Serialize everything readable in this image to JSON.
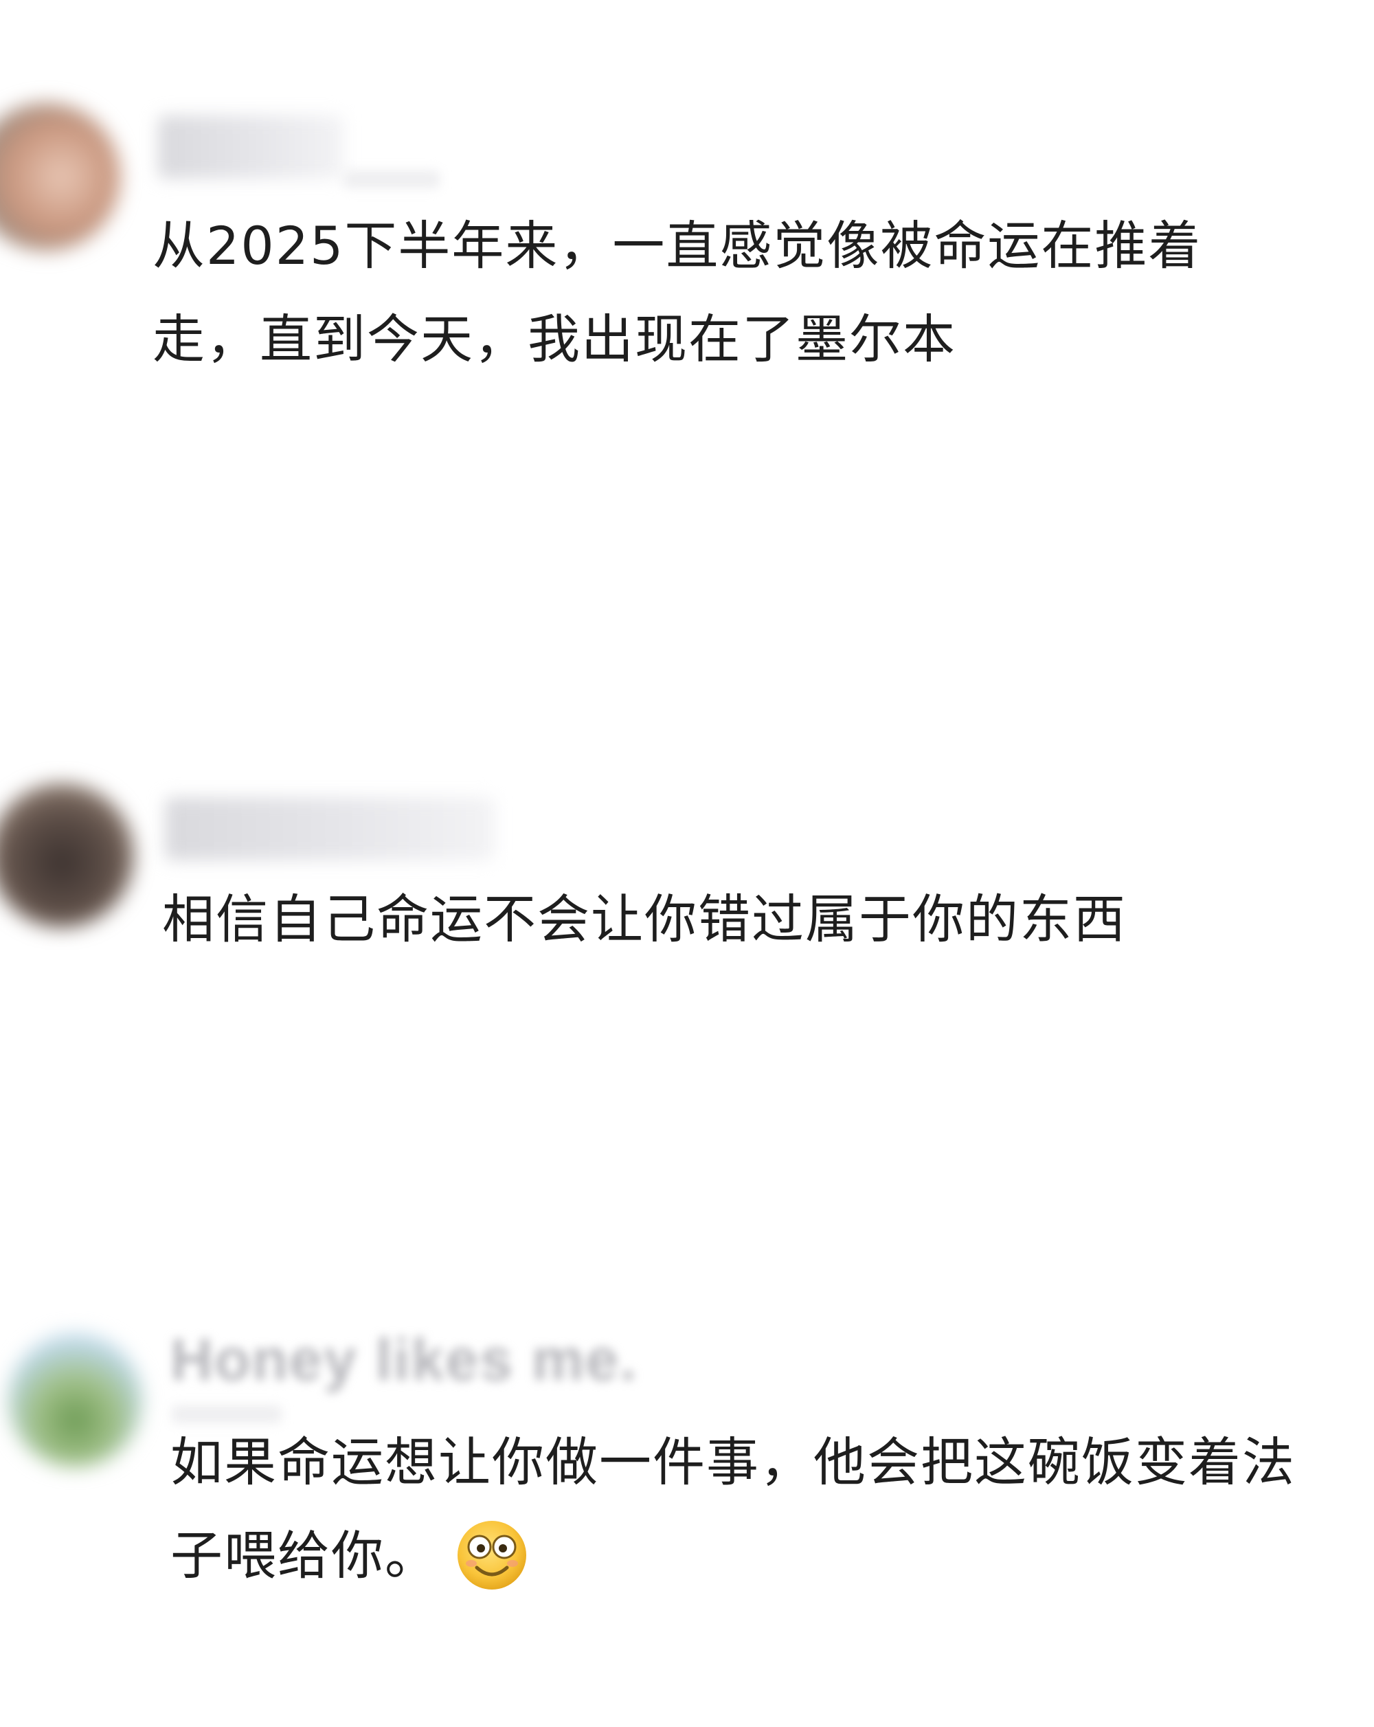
{
  "comments": [
    {
      "username": "",
      "text": "从2025下半年来，一直感觉像被命运在推着走，直到今天，我出现在了墨尔本",
      "avatar_color": "#c9a38f"
    },
    {
      "username": "",
      "text": "相信自己命运不会让你错过属于你的东西",
      "avatar_color": "#5b4d47"
    },
    {
      "username": "Honey likes me.",
      "text": "如果命运想让你做一件事，他会把这碗饭变着法子喂给你。",
      "avatar_color": "#8fb5c9",
      "emoji": "smiling-face-icon"
    }
  ]
}
